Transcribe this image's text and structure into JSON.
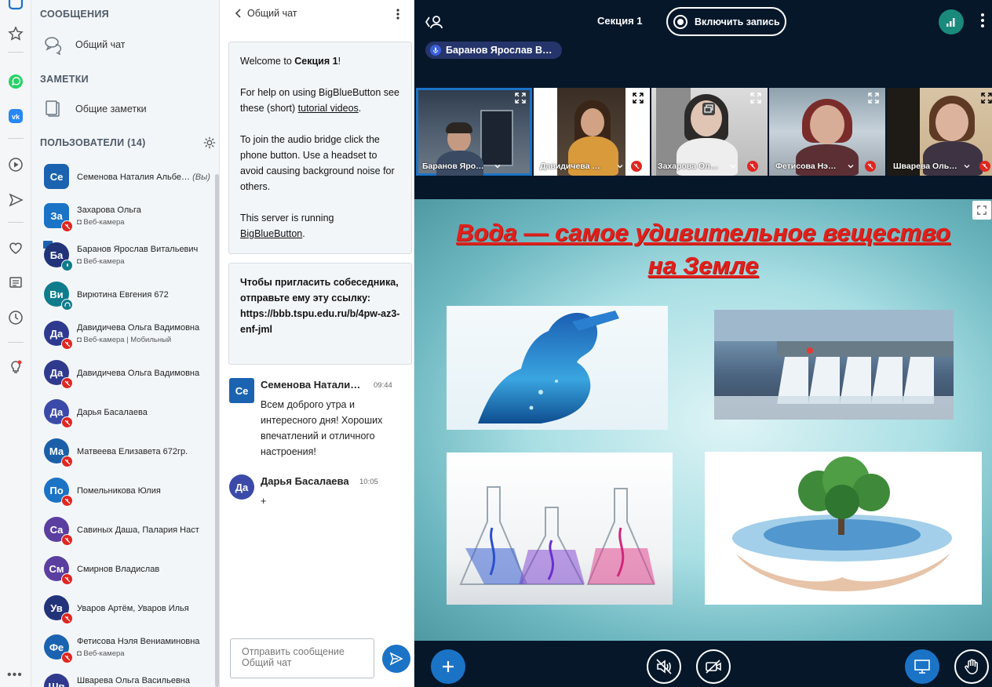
{
  "sidebar": {
    "messages_title": "СООБЩЕНИЯ",
    "public_chat_label": "Общий чат",
    "notes_title": "ЗАМЕТКИ",
    "shared_notes_label": "Общие заметки",
    "users_title": "ПОЛЬЗОВАТЕЛИ (14)",
    "users": [
      {
        "initials": "Се",
        "name": "Семенова Наталия Альбе…",
        "you": "(Вы)",
        "status": "",
        "color": "#1b63b0"
      },
      {
        "initials": "За",
        "name": "Захарова Ольга",
        "status": "Веб-камера",
        "color": "#1b73c6"
      },
      {
        "initials": "Ба",
        "name": "Баранов Ярослав Витальевич",
        "status": "Веб-камера",
        "color": "#22337a"
      },
      {
        "initials": "Ви",
        "name": "Вирютина Евгения 672",
        "status": "",
        "color": "#0f7c8c"
      },
      {
        "initials": "Да",
        "name": "Давидичева Ольга Вадимовна",
        "status": "Веб-камера | Мобильный",
        "color": "#2f3a8f"
      },
      {
        "initials": "Да",
        "name": "Давидичева Ольга Вадимовна",
        "status": "",
        "color": "#2f3a8f"
      },
      {
        "initials": "Да",
        "name": "Дарья Басалаева",
        "status": "",
        "color": "#3b4aa8"
      },
      {
        "initials": "Ма",
        "name": "Матвеева Елизавета 672гр.",
        "status": "",
        "color": "#1b5fa8"
      },
      {
        "initials": "По",
        "name": "Помельникова Юлия",
        "status": "",
        "color": "#1b73c6"
      },
      {
        "initials": "Са",
        "name": "Савиных Даша, Палария Наст",
        "status": "",
        "color": "#5a3fa0"
      },
      {
        "initials": "См",
        "name": "Смирнов Владислав",
        "status": "",
        "color": "#5a3fa0"
      },
      {
        "initials": "Ув",
        "name": "Уваров Артём, Уваров Илья",
        "status": "",
        "color": "#22337a"
      },
      {
        "initials": "Фе",
        "name": "Фетисова Нэля Вениаминовна",
        "status": "Веб-камера",
        "color": "#1b63b0"
      },
      {
        "initials": "Шв",
        "name": "Шварева Ольга Васильевна",
        "status": "",
        "color": "#2f3a8f"
      }
    ]
  },
  "chat": {
    "title": "Общий чат",
    "welcome": {
      "p1_prefix": "Welcome to ",
      "p1_bold": "Секция 1",
      "p1_suffix": "!",
      "p2_prefix": "For help on using BigBlueButton see these (short) ",
      "p2_link": "tutorial videos",
      "p2_suffix": ".",
      "p3": "To join the audio bridge click the phone button. Use a headset to avoid causing background noise for others.",
      "p4_prefix": "This server is running ",
      "p4_link": "BigBlueButton",
      "p4_suffix": "."
    },
    "invite": "Чтобы пригласить собеседника, отправьте ему эту ссылку: https://bbb.tspu.edu.ru/b/4pw-az3-enf-jml",
    "messages": [
      {
        "initials": "Се",
        "name": "Семенова Натали…",
        "time": "09:44",
        "text": "Всем доброго утра и интересного дня! Хороших впечатлений и отличного настроения!",
        "color": "#1b63b0"
      },
      {
        "initials": "Да",
        "name": "Дарья Басалаева",
        "time": "10:05",
        "text": "+",
        "color": "#3b4aa8"
      }
    ],
    "input_placeholder": "Отправить сообщение Общий чат"
  },
  "main": {
    "session_title": "Секция 1",
    "record_label": "Включить запись",
    "talking": "Баранов Ярослав В…",
    "videos": [
      {
        "name": "Баранов Яро…"
      },
      {
        "name": "Давидичева …"
      },
      {
        "name": "Захарова Ол…"
      },
      {
        "name": "Фетисова Нэ…"
      },
      {
        "name": "Шварева Оль…"
      }
    ],
    "slide_title_line1": "Вода — самое удивительное вещество",
    "slide_title_line2": "на Земле"
  },
  "colors": {
    "accent": "#1b73c6",
    "muted": "#df2721",
    "slide_title": "#e0201b",
    "dark_bg": "#06172a"
  }
}
